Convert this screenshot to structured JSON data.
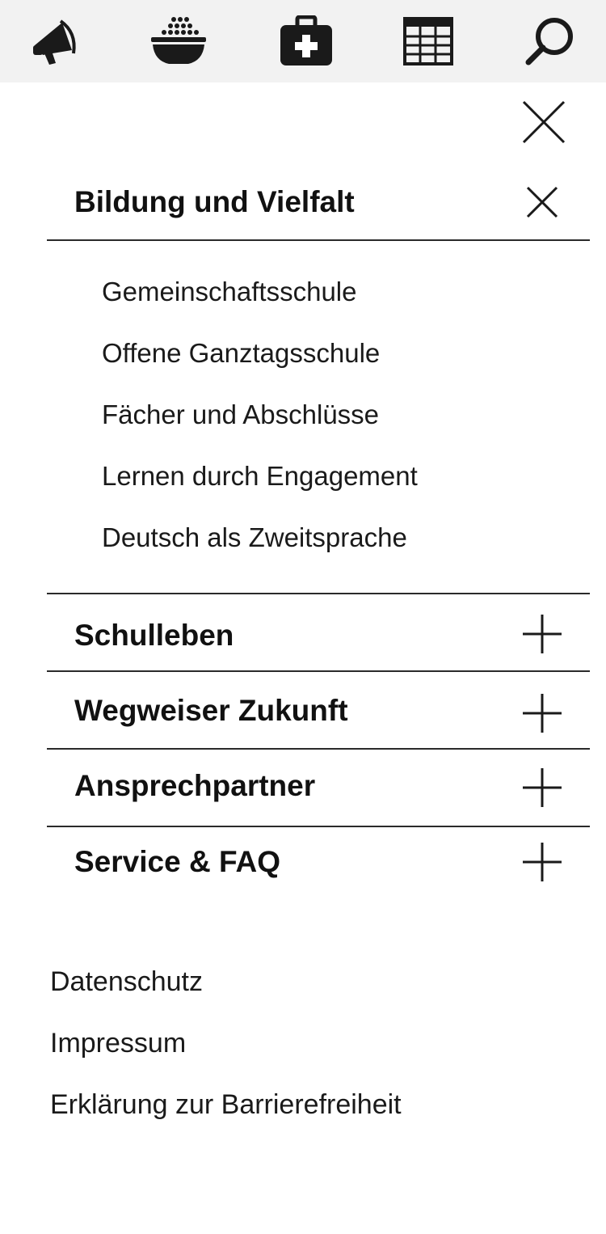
{
  "topbar": {
    "icons": [
      {
        "name": "megaphone-icon",
        "label": "announcements"
      },
      {
        "name": "food-bowl-icon",
        "label": "menu"
      },
      {
        "name": "first-aid-kit-icon",
        "label": "health"
      },
      {
        "name": "calendar-grid-icon",
        "label": "timetable"
      },
      {
        "name": "search-icon",
        "label": "search"
      }
    ]
  },
  "menu": {
    "close_icon": "close-icon",
    "expanded_section": {
      "title": "Bildung und Vielfalt",
      "toggle_icon": "close-icon",
      "items": [
        "Gemeinschaftsschule",
        "Offene Ganztagsschule",
        "Fächer und Abschlüsse",
        "Lernen durch Engagement",
        "Deutsch als Zweitsprache"
      ]
    },
    "collapsed_sections": [
      {
        "title": "Schulleben",
        "toggle_icon": "plus-icon"
      },
      {
        "title": "Wegweiser Zukunft",
        "toggle_icon": "plus-icon"
      },
      {
        "title": "Ansprechpartner",
        "toggle_icon": "plus-icon"
      },
      {
        "title": "Service & FAQ",
        "toggle_icon": "plus-icon"
      }
    ]
  },
  "footer": {
    "links": [
      "Datenschutz",
      "Impressum",
      "Erklärung zur Barrierefreiheit"
    ]
  },
  "colors": {
    "topbar_bg": "#f2f2f2",
    "icon": "#1a1a1a",
    "text": "#111111",
    "divider": "#2a2a2a",
    "background": "#ffffff"
  }
}
